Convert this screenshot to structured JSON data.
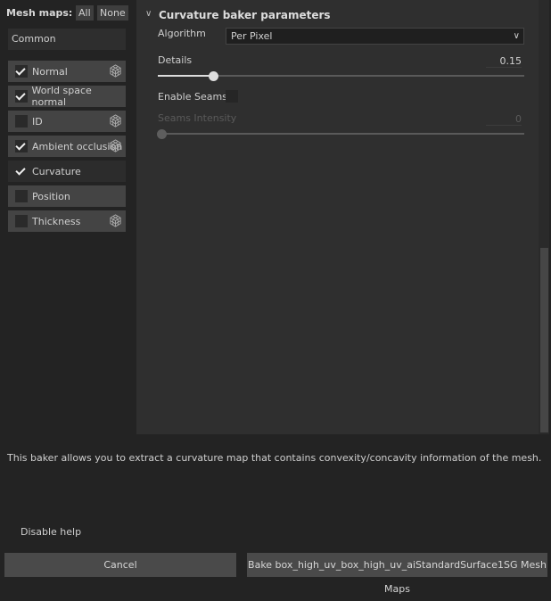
{
  "mesh_maps": {
    "label": "Mesh maps:",
    "all": "All",
    "none": "None",
    "group": "Common",
    "items": [
      {
        "label": "Normal",
        "checked": true,
        "icon": "cube-icon"
      },
      {
        "label": "World space normal",
        "checked": true,
        "icon": null
      },
      {
        "label": "ID",
        "checked": false,
        "icon": "cube-icon"
      },
      {
        "label": "Ambient occlusion",
        "checked": true,
        "icon": "cube-icon"
      },
      {
        "label": "Curvature",
        "checked": true,
        "icon": null,
        "selected": true
      },
      {
        "label": "Position",
        "checked": false,
        "icon": null
      },
      {
        "label": "Thickness",
        "checked": false,
        "icon": "cube-icon"
      }
    ]
  },
  "params": {
    "title": "Curvature baker parameters",
    "algorithm_label": "Algorithm",
    "algorithm_value": "Per Pixel",
    "details_label": "Details",
    "details_value": "0.15",
    "details_fraction": 0.15,
    "enable_seams_label": "Enable Seams",
    "enable_seams": false,
    "seams_intensity_label": "Seams Intensity",
    "seams_intensity_value": "0"
  },
  "help_text": "This baker allows you to extract a curvature map that contains convexity/concavity information of the mesh.",
  "disable_help": "Disable help",
  "cancel": "Cancel",
  "bake": "Bake box_high_uv_box_high_uv_aiStandardSurface1SG Mesh Maps"
}
